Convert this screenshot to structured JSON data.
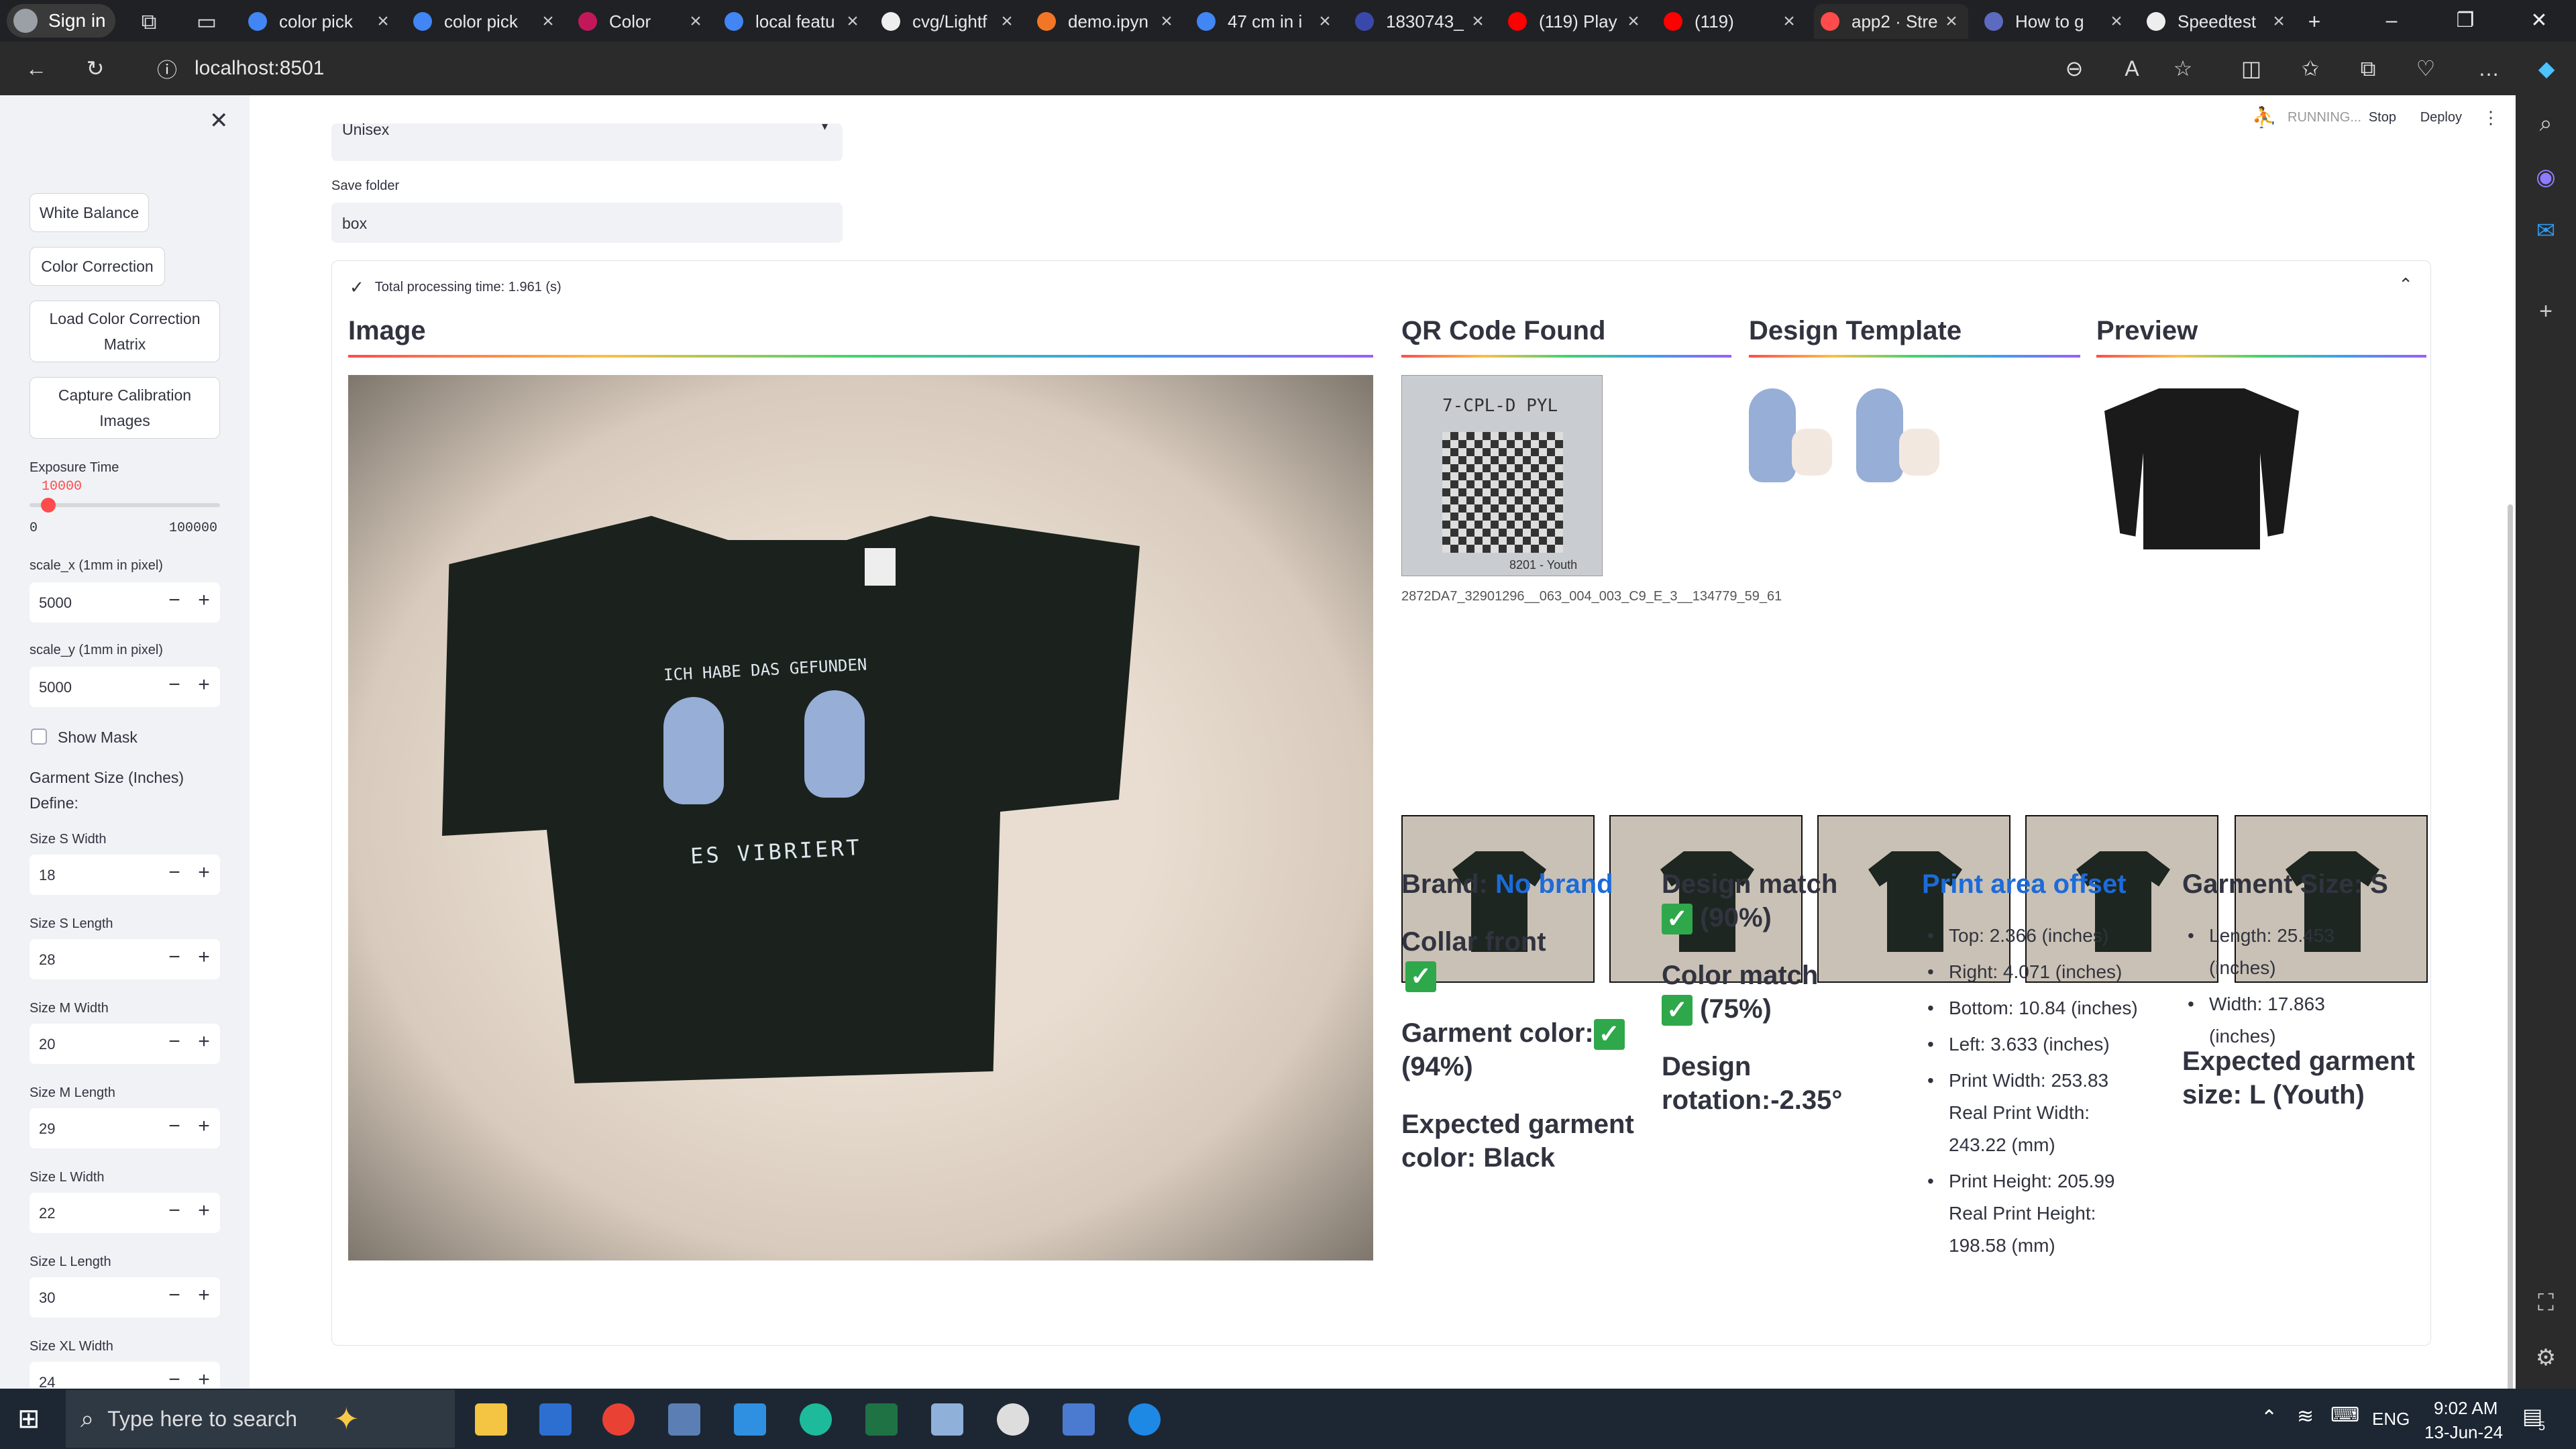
{
  "browser": {
    "signin": "Sign in",
    "tabs": [
      {
        "label": "color pick",
        "icon_color": "#4285f4"
      },
      {
        "label": "color pick",
        "icon_color": "#4285f4"
      },
      {
        "label": "Color",
        "icon_color": "#c2185b"
      },
      {
        "label": "local featu",
        "icon_color": "#4285f4"
      },
      {
        "label": "cvg/Lightf",
        "icon_color": "#eeeeee"
      },
      {
        "label": "demo.ipyn",
        "icon_color": "#f37626"
      },
      {
        "label": "47 cm in i",
        "icon_color": "#4285f4"
      },
      {
        "label": "1830743_",
        "icon_color": "#3949ab"
      },
      {
        "label": "(119) Play",
        "icon_color": "#ff0000"
      },
      {
        "label": "(119)",
        "icon_color": "#ff0000"
      },
      {
        "label": "app2 · Stre",
        "icon_color": "#ff4b4b"
      },
      {
        "label": "How to g",
        "icon_color": "#5c6bc0"
      },
      {
        "label": "Speedtest",
        "icon_color": "#eeeeee"
      }
    ],
    "url": "localhost:8501"
  },
  "sidebar": {
    "buttons": [
      "White Balance",
      "Color Correction",
      "Load Color Correction Matrix",
      "Capture Calibration Images"
    ],
    "exposure": {
      "label": "Exposure Time",
      "value": "10000",
      "min": "0",
      "max": "100000",
      "fraction": 0.1
    },
    "scale_x": {
      "label": "scale_x (1mm in pixel)",
      "value": "5000"
    },
    "scale_y": {
      "label": "scale_y (1mm in pixel)",
      "value": "5000"
    },
    "show_mask": "Show Mask",
    "garment_define": "Garment Size (Inches) Define:",
    "sizes": [
      {
        "label": "Size S Width",
        "value": "18"
      },
      {
        "label": "Size S Length",
        "value": "28"
      },
      {
        "label": "Size M Width",
        "value": "20"
      },
      {
        "label": "Size M Length",
        "value": "29"
      },
      {
        "label": "Size L Width",
        "value": "22"
      },
      {
        "label": "Size L Length",
        "value": "30"
      },
      {
        "label": "Size XL Width",
        "value": "24"
      }
    ]
  },
  "header": {
    "running": "RUNNING...",
    "stop": "Stop",
    "deploy": "Deploy"
  },
  "form": {
    "gender_value": "Unisex",
    "save_folder_label": "Save folder",
    "save_folder_value": "box"
  },
  "result": {
    "status": "Total processing time: 1.961 (s)",
    "headers": {
      "image": "Image",
      "qr": "QR Code Found",
      "design": "Design Template",
      "preview": "Preview"
    },
    "qr_caption": "2872DA7_32901296__063_004_003_C9_E_3__134779_59_61",
    "qr_label_top": "7-CPL-D  PYL",
    "qr_label_bottom": "8201 - Youth",
    "shirt_text_top": "ICH HABE DAS GEFUNDEN",
    "shirt_text_bottom": "ES VIBRIERT",
    "brand_label": "Brand:",
    "brand_value": "No brand",
    "collar": "Collar front",
    "garment_color": "Garment color:",
    "garment_color_pct": "(94%)",
    "expected_color": "Expected garment color: Black",
    "design_match": "Design match",
    "design_match_pct": "(90%)",
    "color_match": "Color match",
    "color_match_pct": "(75%)",
    "rotation": "Design rotation:-2.35°",
    "print_title": "Print area offset",
    "print_items": [
      "Top: 2.366 (inches)",
      "Right: 4.071 (inches)",
      "Bottom: 10.84 (inches)",
      "Left: 3.633 (inches)",
      "Print Width: 253.83 Real Print Width: 243.22 (mm)",
      "Print Height: 205.99 Real Print Height: 198.58 (mm)"
    ],
    "size_title": "Garment Size: S",
    "size_items": [
      "Length: 25.453 (inches)",
      "Width: 17.863 (inches)"
    ],
    "expected_size": "Expected garment size: L (Youth)"
  },
  "taskbar": {
    "search_placeholder": "Type here to search",
    "lang": "ENG",
    "time": "9:02 AM",
    "date": "13-Jun-24",
    "notif": "5"
  }
}
